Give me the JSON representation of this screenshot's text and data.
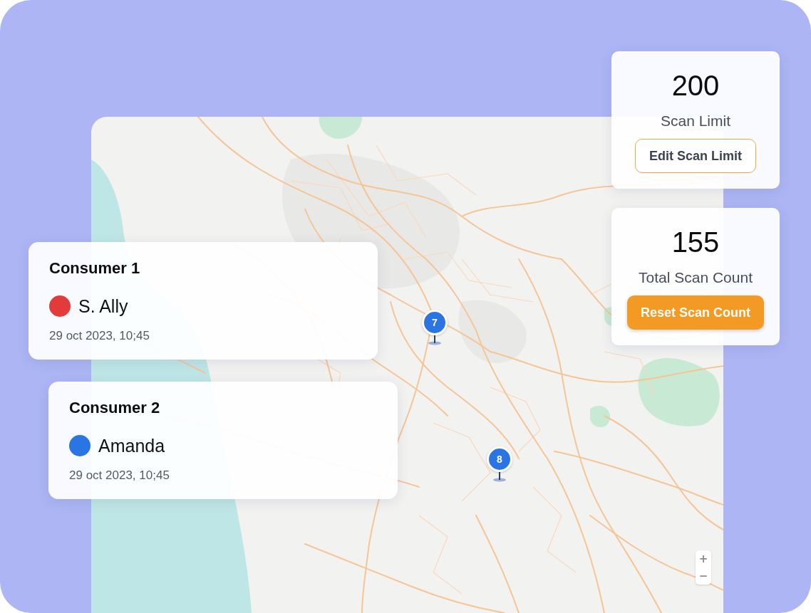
{
  "stat_cards": [
    {
      "value": "200",
      "label": "Scan Limit",
      "button": {
        "kind": "outline",
        "label": "Edit Scan Limit"
      }
    },
    {
      "value": "155",
      "label": "Total Scan Count",
      "button": {
        "kind": "filled",
        "label": "Reset Scan Count"
      }
    }
  ],
  "consumer_cards": [
    {
      "title": "Consumer 1",
      "name": "S. Ally",
      "color": "#e23b3b",
      "time": "29 oct 2023, 10;45"
    },
    {
      "title": "Consumer 2",
      "name": "Amanda",
      "color": "#2a75e3",
      "time": "29 oct 2023, 10;45"
    }
  ],
  "map": {
    "markers": [
      {
        "label": "7"
      },
      {
        "label": "8"
      }
    ],
    "zoom_buttons": [
      "+",
      "−"
    ]
  }
}
